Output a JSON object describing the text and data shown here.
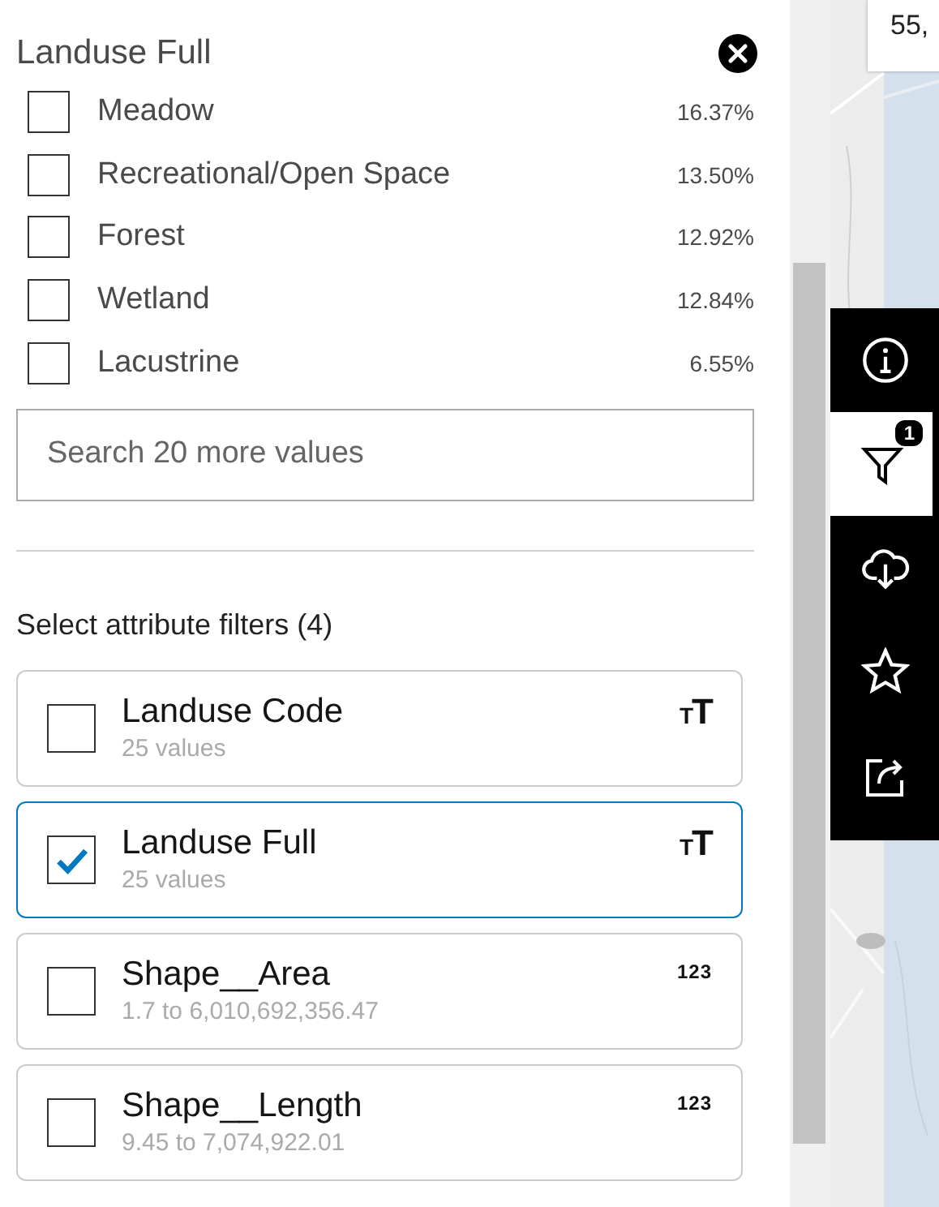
{
  "panel": {
    "title": "Landuse Full",
    "values": [
      {
        "label": "Meadow",
        "percent": "16.37%",
        "checked": false
      },
      {
        "label": "Recreational/Open Space",
        "percent": "13.50%",
        "checked": false
      },
      {
        "label": "Forest",
        "percent": "12.92%",
        "checked": false
      },
      {
        "label": "Wetland",
        "percent": "12.84%",
        "checked": false
      },
      {
        "label": "Lacustrine",
        "percent": "6.55%",
        "checked": false
      }
    ],
    "search": {
      "placeholder": "Search 20 more values"
    },
    "filters_heading": "Select attribute filters (4)",
    "filters": [
      {
        "name": "Landuse Code",
        "detail": "25 values",
        "kind": "string",
        "type_glyph": "TT",
        "selected": false
      },
      {
        "name": "Landuse Full",
        "detail": "25 values",
        "kind": "string",
        "type_glyph": "TT",
        "selected": true
      },
      {
        "name": "Shape__Area",
        "detail": "1.7 to 6,010,692,356.47",
        "kind": "number",
        "type_glyph": "123",
        "selected": false
      },
      {
        "name": "Shape__Length",
        "detail": "9.45 to 7,074,922.01",
        "kind": "number",
        "type_glyph": "123",
        "selected": false
      }
    ]
  },
  "map_card": {
    "text": "55,"
  },
  "toolbar": [
    {
      "kind": "info",
      "selected": false
    },
    {
      "kind": "filter",
      "selected": true,
      "badge": "1"
    },
    {
      "kind": "download",
      "selected": false
    },
    {
      "kind": "favorite",
      "selected": false
    },
    {
      "kind": "share",
      "selected": false
    }
  ]
}
